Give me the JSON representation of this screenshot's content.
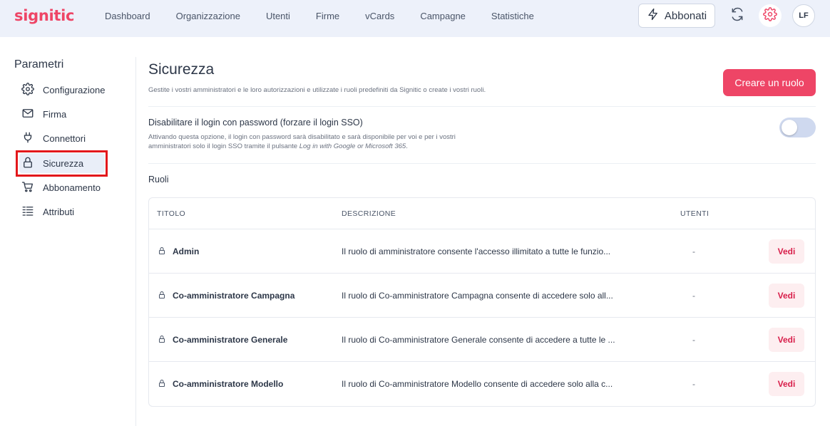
{
  "app": {
    "logo": "signitic",
    "accent_color": "#ee4566"
  },
  "nav": {
    "items": [
      "Dashboard",
      "Organizzazione",
      "Utenti",
      "Firme",
      "vCards",
      "Campagne",
      "Statistiche"
    ],
    "subscribe_label": "Abbonati",
    "avatar_initials": "LF"
  },
  "sidebar": {
    "title": "Parametri",
    "items": [
      {
        "label": "Configurazione",
        "icon": "gear-icon"
      },
      {
        "label": "Firma",
        "icon": "envelope-icon"
      },
      {
        "label": "Connettori",
        "icon": "plug-icon"
      },
      {
        "label": "Sicurezza",
        "icon": "lock-icon",
        "active": true
      },
      {
        "label": "Abbonamento",
        "icon": "cart-icon"
      },
      {
        "label": "Attributi",
        "icon": "list-icon"
      }
    ]
  },
  "main": {
    "title": "Sicurezza",
    "subtitle": "Gestite i vostri amministratori e le loro autorizzazioni e utilizzate i ruoli predefiniti da Signitic o create i vostri ruoli.",
    "create_button": "Creare un ruolo",
    "sso": {
      "title": "Disabilitare il login con password (forzare il login SSO)",
      "desc_prefix": "Attivando questa opzione, il login con password sarà disabilitato e sarà disponibile per voi e per i vostri amministratori solo il login SSO tramite il pulsante",
      "desc_italic": "Log in with Google or Microsoft 365",
      "desc_suffix": ".",
      "enabled": false
    },
    "roles_label": "Ruoli",
    "table": {
      "headers": {
        "title": "TITOLO",
        "description": "DESCRIZIONE",
        "users": "UTENTI"
      },
      "rows": [
        {
          "title": "Admin",
          "description": "Il ruolo di amministratore consente l'accesso illimitato a tutte le funzio...",
          "users": "-",
          "action": "Vedi"
        },
        {
          "title": "Co-amministratore Campagna",
          "description": "Il ruolo di Co-amministratore Campagna consente di accedere solo all...",
          "users": "-",
          "action": "Vedi"
        },
        {
          "title": "Co-amministratore Generale",
          "description": "Il ruolo di Co-amministratore Generale consente di accedere a tutte le ...",
          "users": "-",
          "action": "Vedi"
        },
        {
          "title": "Co-amministratore Modello",
          "description": "Il ruolo di Co-amministratore Modello consente di accedere solo alla c...",
          "users": "-",
          "action": "Vedi"
        }
      ]
    }
  }
}
